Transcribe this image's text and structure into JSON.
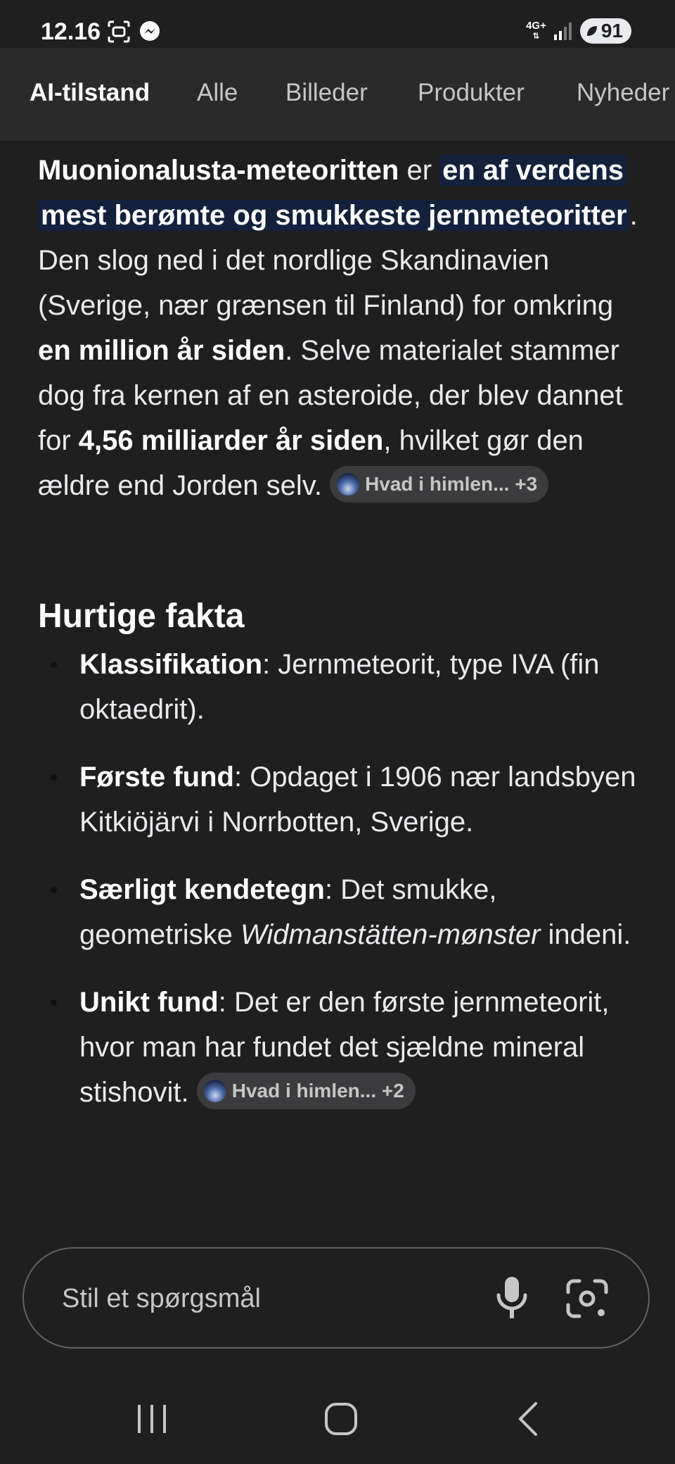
{
  "status": {
    "time": "12.16",
    "network": "4G+",
    "battery": "91"
  },
  "tabs": [
    {
      "label": "AI-tilstand",
      "active": true
    },
    {
      "label": "Alle",
      "active": false
    },
    {
      "label": "Billeder",
      "active": false
    },
    {
      "label": "Produkter",
      "active": false
    },
    {
      "label": "Nyheder",
      "active": false
    }
  ],
  "answer": {
    "p1_bold": "Muonionalusta-meteoritten",
    "p1_er": " er ",
    "p1_highlight": "en af verdens mest berømte og smukkeste jernmeteoritter",
    "p1_text1": ". Den slog ned i det nordlige Skandinavien (Sverige, nær grænsen til Finland) for omkring ",
    "p1_bold2": "en million år siden",
    "p1_text2": ". Selve materialet stammer dog fra kernen af en asteroide, der blev dannet for ",
    "p1_bold3": "4,56 milliarder år siden",
    "p1_text3": ", hvilket gør den ældre end Jorden selv.",
    "chip1": "Hvad i himlen... +3"
  },
  "quick_facts": {
    "heading": "Hurtige fakta",
    "f1_label": "Klassifikation",
    "f1_text": ": Jernmeteorit, type IVA (fin oktaedrit).",
    "f2_label": "Første fund",
    "f2_text": ": Opdaget i 1906 nær landsbyen Kitkiöjärvi i Norrbotten, Sverige.",
    "f3_label": "Særligt kendetegn",
    "f3_text1": ": Det smukke, geometriske ",
    "f3_italic": "Widmanstätten-mønster",
    "f3_text2": " indeni.",
    "f4_label": "Unikt fund",
    "f4_text": ": Det er den første jernmeteorit, hvor man har fundet det sjældne mineral stishovit.",
    "chip2": "Hvad i himlen... +2"
  },
  "ask": {
    "placeholder": "Stil et spørgsmål"
  },
  "icons": {
    "mic": "microphone-icon",
    "lens": "camera-lens-icon",
    "recents": "recent-apps-icon",
    "home": "home-icon",
    "back": "back-icon"
  }
}
